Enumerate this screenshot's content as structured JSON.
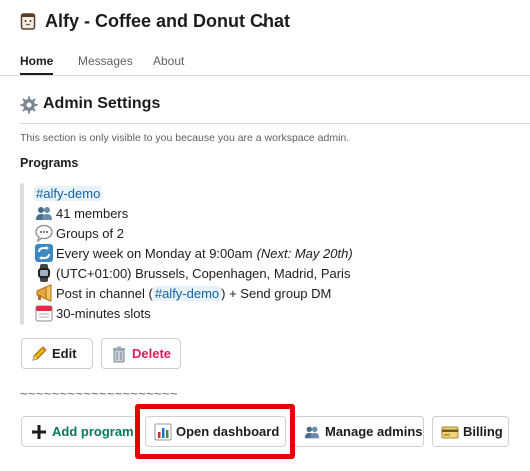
{
  "app": {
    "title": "Alfy - Coffee and Donut Chat"
  },
  "tabs": [
    {
      "label": "Home",
      "active": true
    },
    {
      "label": "Messages",
      "active": false
    },
    {
      "label": "About",
      "active": false
    }
  ],
  "admin": {
    "title": "Admin Settings",
    "note": "This section is only visible to you because you are a workspace admin."
  },
  "programs": {
    "heading": "Programs",
    "item": {
      "channel": "#alfy-demo",
      "members": "41 members",
      "groups": "Groups of 2",
      "schedule": "Every week on Monday at 9:00am",
      "schedule_next": "(Next: May 20th)",
      "timezone": "(UTC+01:00) Brussels, Copenhagen, Madrid, Paris",
      "post_prefix": "Post in channel (",
      "post_channel": "#alfy-demo",
      "post_suffix": ") + Send group DM",
      "slots": "30-minutes slots"
    }
  },
  "buttons": {
    "edit": "Edit",
    "delete": "Delete",
    "add_program": "Add program",
    "open_dashboard": "Open dashboard",
    "manage_admins": "Manage admins",
    "billing": "Billing"
  },
  "divider_text": "~~~~~~~~~~~~~~~~~~~~",
  "colors": {
    "text": "#1d1c1d",
    "muted": "#616061",
    "link": "#1264a3",
    "danger": "#e01e5a",
    "success": "#007a5a",
    "highlight": "#e60000"
  },
  "icons": {
    "app": "coffee-cup-icon",
    "title_dropdown": "chevron-down-icon",
    "admin": "gear-icon",
    "members": "people-icon",
    "groups": "speech-bubble-icon",
    "schedule": "repeat-icon",
    "timezone": "watch-icon",
    "post": "megaphone-icon",
    "slots": "calendar-icon",
    "edit": "pencil-icon",
    "delete": "trash-icon",
    "add_program": "plus-icon",
    "open_dashboard": "bar-chart-icon",
    "manage_admins": "people-icon",
    "billing": "credit-card-icon"
  }
}
